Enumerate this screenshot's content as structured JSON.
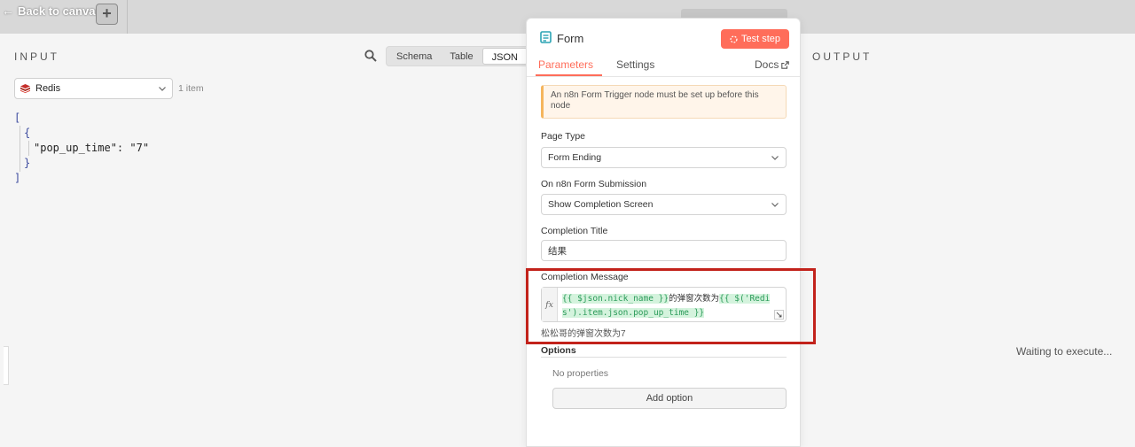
{
  "topbar": {
    "back_label": "Back to canvas",
    "add_label": "+"
  },
  "input": {
    "title": "INPUT",
    "view_modes": [
      "Schema",
      "Table",
      "JSON"
    ],
    "active_view": "JSON",
    "source_node": "Redis",
    "item_count": "1 item",
    "json_lines": {
      "l1": "[",
      "l2": "{",
      "key": "\"pop_up_time\"",
      "colon": ": ",
      "value": "\"7\"",
      "l4": "}",
      "l5": "]"
    }
  },
  "output": {
    "title": "OUTPUT",
    "waiting": "Waiting to execute..."
  },
  "panel": {
    "title": "Form",
    "test_button": "Test step",
    "tabs": [
      "Parameters",
      "Settings"
    ],
    "active_tab": "Parameters",
    "docs_label": "Docs",
    "notice": "An n8n Form Trigger node must be set up before this node",
    "fields": {
      "page_type": {
        "label": "Page Type",
        "value": "Form Ending"
      },
      "on_submission": {
        "label": "On n8n Form Submission",
        "value": "Show Completion Screen"
      },
      "completion_title": {
        "label": "Completion Title",
        "value": "结果"
      },
      "completion_message": {
        "label": "Completion Message",
        "fx": "fx",
        "expr_part1": "{{ $json.nick_name }}",
        "expr_mid": "的弹窗次数为",
        "expr_part2": "{{ $('Redis').item.json.pop_up_time }}",
        "result": "松松哥的弹窗次数为7"
      }
    },
    "options": {
      "label": "Options",
      "empty": "No properties",
      "add_button": "Add option"
    }
  },
  "colors": {
    "accent": "#ff6d5a",
    "highlight_frame": "#c2221b",
    "expr_green": "#2c9b5a"
  }
}
